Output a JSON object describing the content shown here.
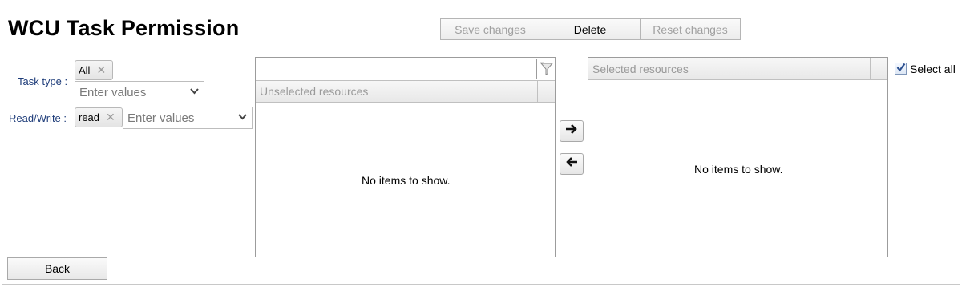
{
  "page": {
    "title": "WCU Task Permission"
  },
  "toolbar": {
    "save_label": "Save changes",
    "delete_label": "Delete",
    "reset_label": "Reset changes"
  },
  "filters": {
    "task_type_label": "Task type :",
    "task_type_chip": "All",
    "task_type_placeholder": "Enter values",
    "read_write_label": "Read/Write :",
    "read_write_chip": "read",
    "read_write_placeholder": "Enter values"
  },
  "unselected": {
    "filter_value": "",
    "header": "Unselected resources",
    "empty_text": "No items to show."
  },
  "selected": {
    "header": "Selected resources",
    "empty_text": "No items to show.",
    "select_all_label": "Select all",
    "select_all_checked": true
  },
  "footer": {
    "back_label": "Back"
  },
  "icons": {
    "filter": "funnel-icon",
    "move_right": "arrow-right-icon",
    "move_left": "arrow-left-icon",
    "remove_chip": "close-icon",
    "dropdown": "chevron-down-icon",
    "checkmark": "check-icon"
  }
}
